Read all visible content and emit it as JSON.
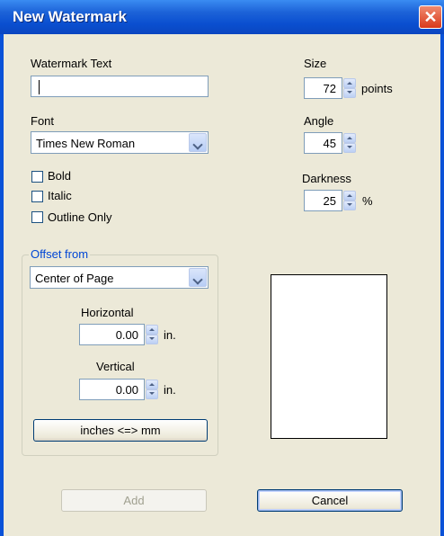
{
  "dialog": {
    "title": "New Watermark",
    "close_glyph": "✕"
  },
  "watermark_text": {
    "label": "Watermark Text",
    "value": ""
  },
  "font": {
    "label": "Font",
    "value": "Times New Roman"
  },
  "style_options": [
    {
      "label": "Bold",
      "checked": false
    },
    {
      "label": "Italic",
      "checked": false
    },
    {
      "label": "Outline Only",
      "checked": false
    }
  ],
  "offset": {
    "group_label": "Offset from",
    "value": "Center of Page",
    "horizontal_label": "Horizontal",
    "horizontal_value": "0.00",
    "horizontal_unit": "in.",
    "vertical_label": "Vertical",
    "vertical_value": "0.00",
    "vertical_unit": "in.",
    "convert_button": "inches <=> mm"
  },
  "size": {
    "label": "Size",
    "value": "72",
    "unit": "points"
  },
  "angle": {
    "label": "Angle",
    "value": "45"
  },
  "darkness": {
    "label": "Darkness",
    "value": "25",
    "unit": "%"
  },
  "buttons": {
    "add": "Add",
    "cancel": "Cancel"
  },
  "colors": {
    "title_bar": "#0a4fd0",
    "dialog_bg": "#ece9d8",
    "group_label": "#0046d5"
  }
}
